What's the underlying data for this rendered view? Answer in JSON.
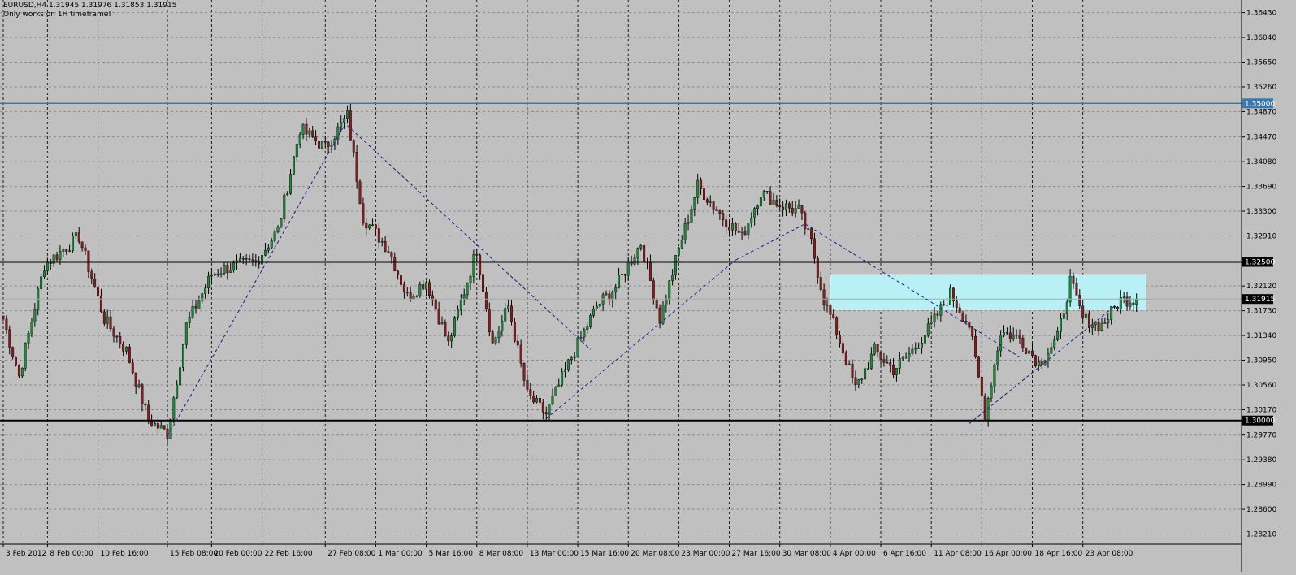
{
  "header": {
    "symbol_line": "EURUSD,H4  1.31945 1.31976 1.31853 1.31915",
    "note": "Only works on 1H timeframe!"
  },
  "colors": {
    "background": "#c0c0c0",
    "grid": "#8a8a8a",
    "bull": "#1e8c3a",
    "bear": "#8c1c1c",
    "wick": "#000000",
    "trendline": "#1a1a8c",
    "resistance_blue": "#3a78b4",
    "level_black": "#000000",
    "zone_fill": "#b8f0f6"
  },
  "chart_data": {
    "type": "candlestick",
    "symbol": "EURUSD",
    "timeframe": "H4",
    "ohlc_last": {
      "open": 1.31945,
      "high": 1.31976,
      "low": 1.31853,
      "close": 1.31915
    },
    "ylim": [
      1.2805,
      1.3663
    ],
    "y_ticks": [
      "1.36430",
      "1.36040",
      "1.35650",
      "1.35260",
      "1.34870",
      "1.34470",
      "1.34080",
      "1.33690",
      "1.33300",
      "1.32910",
      "1.32120",
      "1.31730",
      "1.31340",
      "1.30950",
      "1.30560",
      "1.30170",
      "1.29770",
      "1.29380",
      "1.28990",
      "1.28600",
      "1.28210"
    ],
    "x_ticks": [
      "3 Feb 2012",
      "8 Feb 00:00",
      "10 Feb 16:00",
      "15 Feb 08:00",
      "20 Feb 00:00",
      "22 Feb 16:00",
      "27 Feb 08:00",
      "1 Mar 00:00",
      "5 Mar 16:00",
      "8 Mar 08:00",
      "13 Mar 00:00",
      "15 Mar 16:00",
      "20 Mar 08:00",
      "23 Mar 00:00",
      "27 Mar 16:00",
      "30 Mar 08:00",
      "4 Apr 00:00",
      "6 Apr 16:00",
      "11 Apr 08:00",
      "16 Apr 00:00",
      "18 Apr 16:00",
      "23 Apr 08:00"
    ],
    "x_tick_index": [
      0,
      14,
      30,
      52,
      66,
      82,
      102,
      118,
      134,
      150,
      166,
      182,
      198,
      214,
      230,
      246,
      262,
      278,
      294,
      310,
      326,
      342
    ],
    "swing_points": [
      [
        0,
        1.316
      ],
      [
        5,
        1.307
      ],
      [
        13,
        1.3245
      ],
      [
        24,
        1.329
      ],
      [
        32,
        1.316
      ],
      [
        39,
        1.311
      ],
      [
        46,
        1.3
      ],
      [
        52,
        1.298
      ],
      [
        58,
        1.315
      ],
      [
        66,
        1.323
      ],
      [
        70,
        1.324
      ],
      [
        80,
        1.325
      ],
      [
        87,
        1.33
      ],
      [
        94,
        1.346
      ],
      [
        102,
        1.343
      ],
      [
        109,
        1.348
      ],
      [
        114,
        1.332
      ],
      [
        122,
        1.327
      ],
      [
        128,
        1.3195
      ],
      [
        134,
        1.322
      ],
      [
        141,
        1.312
      ],
      [
        150,
        1.327
      ],
      [
        155,
        1.312
      ],
      [
        160,
        1.318
      ],
      [
        166,
        1.304
      ],
      [
        172,
        1.301
      ],
      [
        180,
        1.31
      ],
      [
        188,
        1.318
      ],
      [
        194,
        1.321
      ],
      [
        202,
        1.328
      ],
      [
        208,
        1.316
      ],
      [
        214,
        1.327
      ],
      [
        220,
        1.337
      ],
      [
        228,
        1.332
      ],
      [
        234,
        1.329
      ],
      [
        240,
        1.336
      ],
      [
        246,
        1.334
      ],
      [
        252,
        1.333
      ],
      [
        256,
        1.328
      ],
      [
        260,
        1.319
      ],
      [
        264,
        1.314
      ],
      [
        270,
        1.305
      ],
      [
        276,
        1.311
      ],
      [
        282,
        1.308
      ],
      [
        288,
        1.311
      ],
      [
        294,
        1.315
      ],
      [
        300,
        1.32
      ],
      [
        306,
        1.315
      ],
      [
        311,
        1.301
      ],
      [
        316,
        1.314
      ],
      [
        322,
        1.313
      ],
      [
        328,
        1.309
      ],
      [
        334,
        1.313
      ],
      [
        338,
        1.322
      ],
      [
        342,
        1.316
      ],
      [
        348,
        1.315
      ],
      [
        354,
        1.319
      ],
      [
        359,
        1.31915
      ]
    ],
    "n_bars": 360,
    "levels": [
      {
        "price": 1.35,
        "label": "1.35000",
        "style": "blue"
      },
      {
        "price": 1.325,
        "label": "1.32500",
        "style": "black"
      },
      {
        "price": 1.31915,
        "label": "1.31915",
        "style": "current"
      },
      {
        "price": 1.3,
        "label": "1.30000",
        "style": "black"
      }
    ],
    "trendlines": [
      [
        52,
        1.2975,
        108,
        1.3465
      ],
      [
        109,
        1.3465,
        186,
        1.3112
      ],
      [
        172,
        1.3003,
        232,
        1.3253
      ],
      [
        232,
        1.3253,
        254,
        1.331
      ],
      [
        254,
        1.331,
        322,
        1.31
      ],
      [
        306,
        1.2995,
        352,
        1.318
      ]
    ],
    "zone": {
      "x_start": 262,
      "x_end": 362,
      "price_top": 1.323,
      "price_bottom": 1.3175
    }
  }
}
